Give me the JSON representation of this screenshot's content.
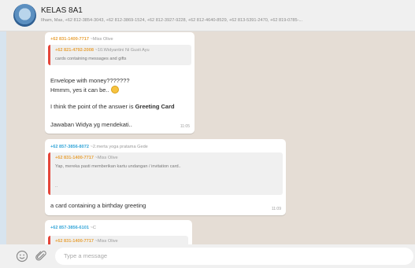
{
  "header": {
    "group_name": "KELAS 8A1",
    "members": "Ilham, Mas, +62 812-3854-3043, +62 812-3869-1524, +62 812-3927-9228, +62 812-4640-8529, +62 813-5391-2470, +62 819-0785-..."
  },
  "messages": [
    {
      "sender_phone": "+62 831-1400-7717",
      "sender_alias": "~Miss Olive",
      "quote": {
        "sender_phone": "+62 821-4792-2008",
        "sender_alias": "~10.Widyantini Ni Gusti Ayu",
        "text": "cards containing messages and gifts"
      },
      "lines": [
        "Envelope with money???????",
        "Hmmm, yes it can be.."
      ],
      "answer_prefix": "I think the point of the answer is ",
      "answer_bold": "Greeting Card",
      "footer_text": "Jawaban Widya yg mendekati..",
      "time": "11:05"
    },
    {
      "sender_phone": "+62 857-3856-8072",
      "sender_alias": "~2.merta yoga pratama Gede",
      "quote": {
        "sender_phone": "+62 831-1400-7717",
        "sender_alias": "~Miss Olive",
        "text": "Yap, mereka pasti memberikan kartu undangan / invitation card..",
        "extra": ".."
      },
      "text": "a card containing a birthday greeting",
      "time": "11:09"
    },
    {
      "sender_phone": "+62 857-3856-6101",
      "sender_alias": "~C",
      "quote": {
        "sender_phone": "+62 831-1400-7717",
        "sender_alias": "~Miss Olive"
      }
    }
  ],
  "composer": {
    "placeholder": "Type a message",
    "emoji_icon": "smiley-icon",
    "attach_icon": "paperclip-icon"
  },
  "colors": {
    "header_bg": "#f0f0f0",
    "chat_bg": "#e5ddd5",
    "phone_blue": "#35a6d8",
    "phone_orange": "#e8a23a",
    "quote_bar": "#e5463a"
  }
}
